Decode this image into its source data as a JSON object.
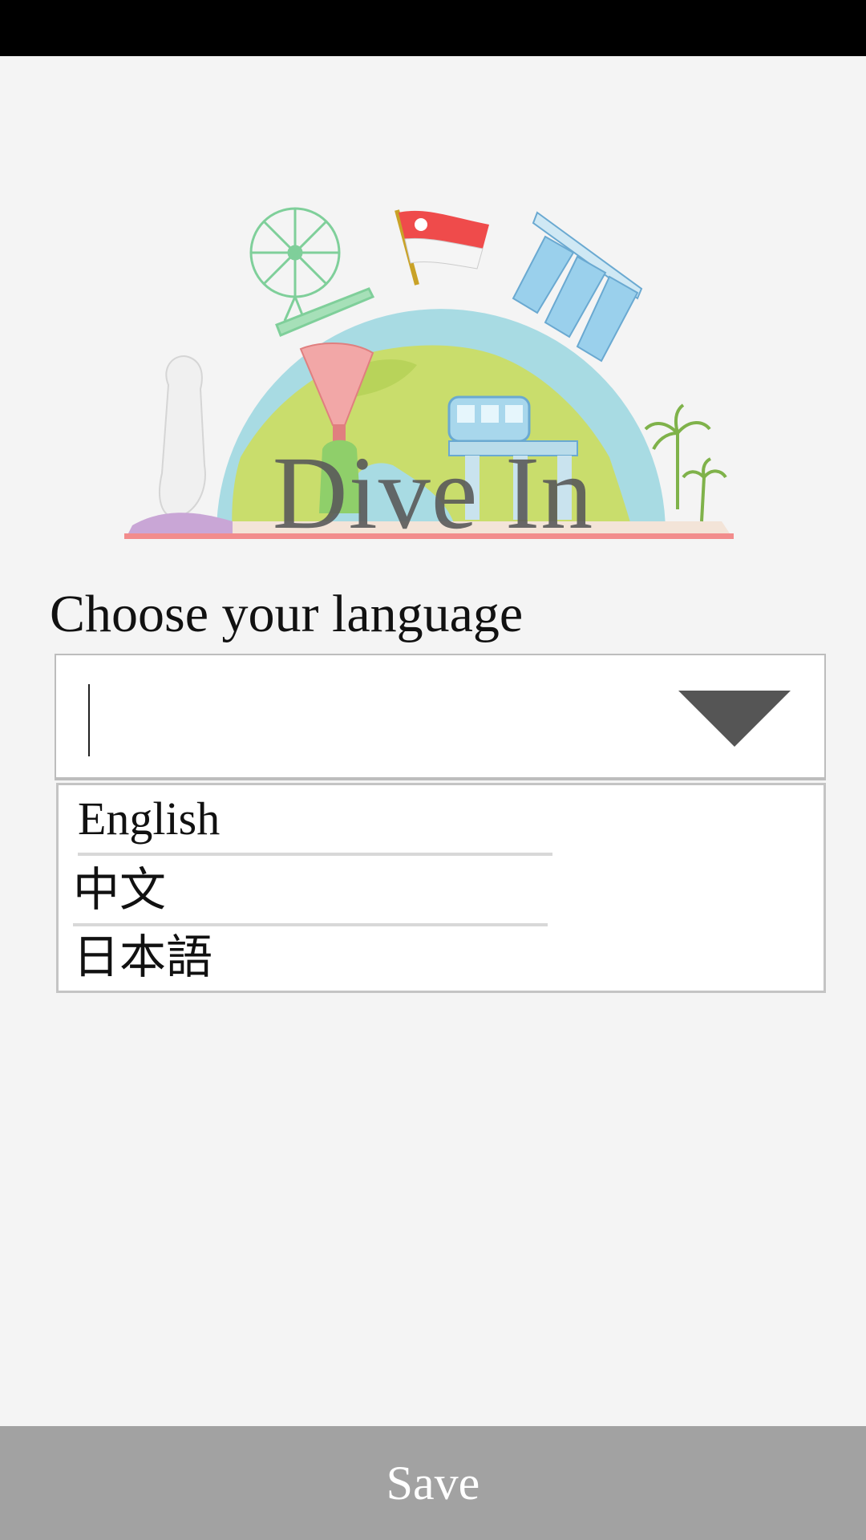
{
  "header": {
    "app_title": "Dive In",
    "hero_image": "singapore-landmarks-illustration"
  },
  "language_picker": {
    "label": "Choose your language",
    "input_value": "",
    "dropdown_icon": "triangle-down-icon",
    "options": [
      "English",
      "中文",
      "日本語"
    ]
  },
  "footer": {
    "save_label": "Save"
  },
  "colors": {
    "background": "#f4f4f4",
    "status_bar": "#000000",
    "save_bar": "#a2a2a2",
    "globe_land": "#c9dd6c",
    "globe_water": "#a8dbe3",
    "flag_red": "#ef4b4b"
  }
}
